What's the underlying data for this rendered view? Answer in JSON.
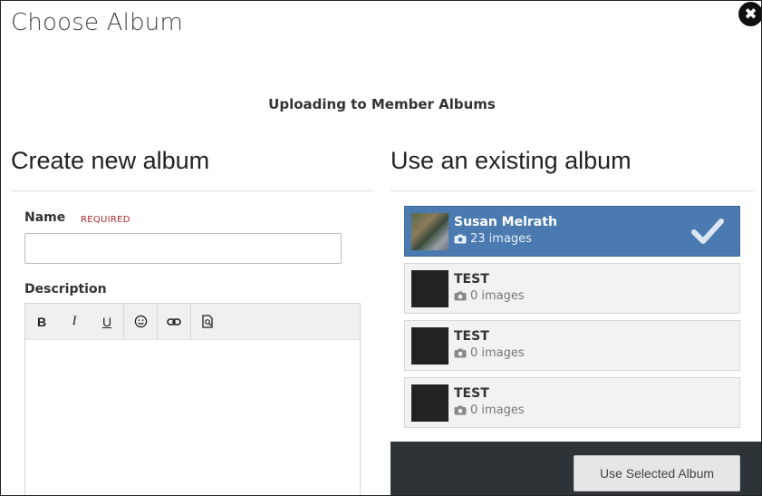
{
  "modal": {
    "title": "Choose Album",
    "close_glyph": "✖"
  },
  "uploading_text": "Uploading to Member Albums",
  "create": {
    "heading": "Create new album",
    "name_label": "Name",
    "required_label": "REQUIRED",
    "name_value": "",
    "description_label": "Description",
    "toolbar": {
      "bold": "B",
      "italic": "I",
      "underline": "U"
    }
  },
  "existing": {
    "heading": "Use an existing album",
    "albums": [
      {
        "name": "Susan Melrath",
        "count": "23 images",
        "selected": true
      },
      {
        "name": "TEST",
        "count": "0 images",
        "selected": false
      },
      {
        "name": "TEST",
        "count": "0 images",
        "selected": false
      },
      {
        "name": "TEST",
        "count": "0 images",
        "selected": false
      }
    ],
    "use_button": "Use Selected Album"
  },
  "colors": {
    "selected_bg": "#4a7ab0",
    "footer_bg": "#2e3338",
    "required": "#b0262a"
  }
}
